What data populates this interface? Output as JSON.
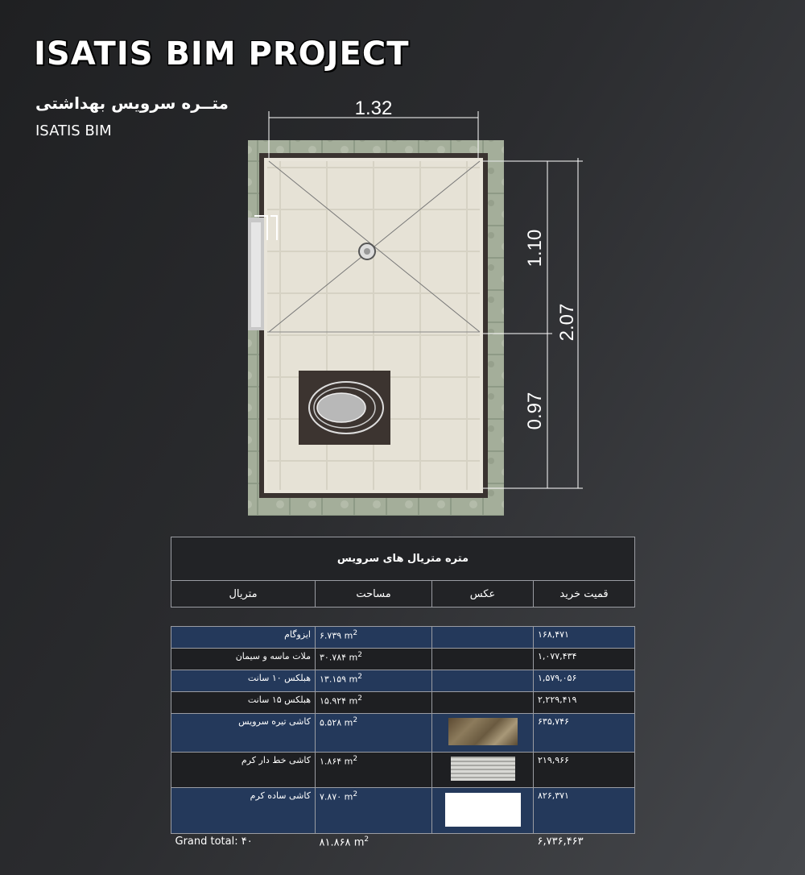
{
  "header": {
    "title": "ISATIS BIM PROJECT",
    "subtitle_fa": "متــره سرویس بهداشتی",
    "subtitle_en": "ISATIS BIM"
  },
  "plan": {
    "dim_width": "1.32",
    "dim_upper": "1.10",
    "dim_total": "2.07",
    "dim_lower": "0.97"
  },
  "table": {
    "caption": "متره متریال های سرویس",
    "columns": {
      "material": "متریال",
      "area": "مساحت",
      "photo": "عکس",
      "price": "قمیت خرید"
    },
    "area_unit": "m",
    "area_sup": "2",
    "rows": [
      {
        "material": "ایزوگام",
        "area": "۶.۷۳۹",
        "price": "۱۶۸,۴۷۱",
        "photo": ""
      },
      {
        "material": "ملات ماسه و سیمان",
        "area": "۳۰.۷۸۴",
        "price": "۱,۰۷۷,۴۳۴",
        "photo": ""
      },
      {
        "material": "هبلکس ۱۰ سانت",
        "area": "۱۳.۱۵۹",
        "price": "۱,۵۷۹,۰۵۶",
        "photo": ""
      },
      {
        "material": "هبلکس ۱۵ سانت",
        "area": "۱۵.۹۲۴",
        "price": "۲,۲۲۹,۴۱۹",
        "photo": ""
      },
      {
        "material": "کاشی تیره سرویس",
        "area": "۵.۵۲۸",
        "price": "۶۳۵,۷۴۶",
        "photo": "marble-swatch"
      },
      {
        "material": "کاشی خط دار کرم",
        "area": "۱.۸۶۴",
        "price": "۲۱۹,۹۶۶",
        "photo": "striped-tile-swatch"
      },
      {
        "material": "کاشی ساده کرم",
        "area": "۷.۸۷۰",
        "price": "۸۲۶,۳۷۱",
        "photo": "plain-tile-swatch"
      }
    ],
    "total": {
      "label": "Grand total: ۴۰",
      "area": "۸۱.۸۶۸",
      "price": "۶,۷۳۶,۴۶۳"
    }
  }
}
